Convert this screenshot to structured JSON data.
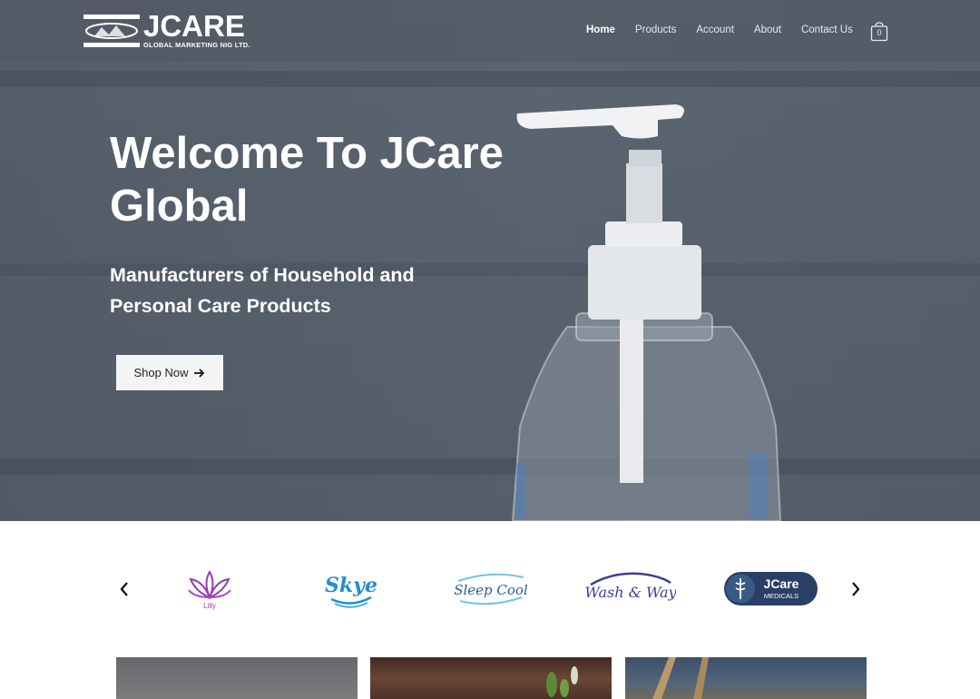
{
  "header": {
    "logo_brand": "JCARE",
    "logo_tagline": "GLOBAL MARKETING NIG LTD.",
    "nav": [
      {
        "label": "Home"
      },
      {
        "label": "Products"
      },
      {
        "label": "Account"
      },
      {
        "label": "About"
      },
      {
        "label": "Contact Us"
      }
    ],
    "cart_count": "0"
  },
  "hero": {
    "title": "Welcome To JCare Global",
    "subtitle": "Manufacturers of Household and Personal Care Products",
    "button_label": "Shop Now",
    "button_icon": "arrow-right-icon"
  },
  "brands": {
    "items": [
      {
        "name": "Lilly",
        "color": "#8e3fae"
      },
      {
        "name": "Skye",
        "color": "#1f8fd6"
      },
      {
        "name": "Sleep Cool",
        "color": "#2a5aa8"
      },
      {
        "name": "Wash & Way",
        "color": "#3c3f9a"
      },
      {
        "name": "JCare",
        "sub": "MEDICALS",
        "color": "#2a3f66"
      }
    ],
    "prev_icon": "chevron-left-icon",
    "next_icon": "chevron-right-icon"
  },
  "colors": {
    "hero_bg": "#5a6470",
    "button_bg": "#f4f4f4",
    "text_light": "#ffffff"
  }
}
